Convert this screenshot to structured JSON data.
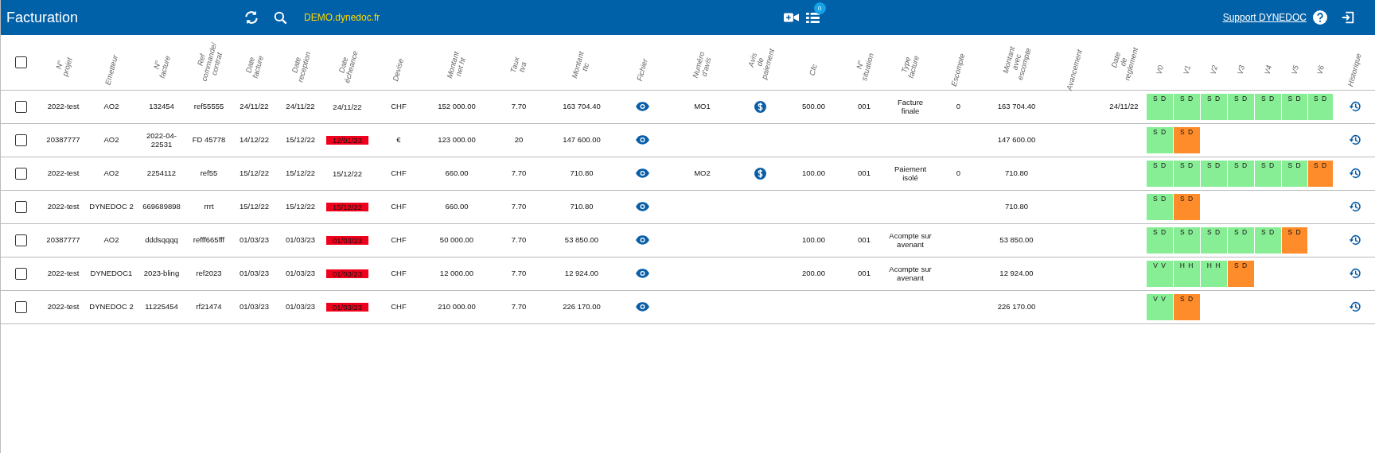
{
  "top_bar": {
    "title": "Facturation",
    "domain": "DEMO.dynedoc.fr",
    "notification_count": "0",
    "support_link": "Support DYNEDOC"
  },
  "table": {
    "all_selected": false,
    "columns": [
      {
        "label": "N°\nprojet",
        "kind": "text"
      },
      {
        "label": "Emetteur",
        "kind": "text"
      },
      {
        "label": "N°\nfacture",
        "kind": "text"
      },
      {
        "label": "Ref\ncommande/\ncontrat",
        "kind": "text"
      },
      {
        "label": "Date\nfacture",
        "kind": "text"
      },
      {
        "label": "Date\nreception",
        "kind": "text"
      },
      {
        "label": "Date\nécheance",
        "kind": "due"
      },
      {
        "label": "Devise",
        "kind": "text"
      },
      {
        "label": "Montant\nnet ht",
        "kind": "text"
      },
      {
        "label": "Taux\ntva",
        "kind": "text"
      },
      {
        "label": "Montant\nttc",
        "kind": "text"
      },
      {
        "label": "Fichier",
        "kind": "file"
      },
      {
        "label": "Numéro\nd'avis",
        "kind": "text"
      },
      {
        "label": "Avis\nde\npaiement",
        "kind": "payment"
      },
      {
        "label": "Cfc",
        "kind": "text"
      },
      {
        "label": "N°\nsituation",
        "kind": "text"
      },
      {
        "label": "Type\nfacture",
        "kind": "text"
      },
      {
        "label": "Escompte",
        "kind": "text"
      },
      {
        "label": "Montant\navec\nescompte",
        "kind": "text"
      },
      {
        "label": "Avancement",
        "kind": "text"
      },
      {
        "label": "Date\nde\nreglement",
        "kind": "text"
      },
      {
        "label": "V0",
        "kind": "version"
      },
      {
        "label": "V1",
        "kind": "version"
      },
      {
        "label": "V2",
        "kind": "version"
      },
      {
        "label": "V3",
        "kind": "version"
      },
      {
        "label": "V4",
        "kind": "version"
      },
      {
        "label": "V5",
        "kind": "version"
      },
      {
        "label": "V6",
        "kind": "version"
      },
      {
        "label": "Historique",
        "kind": "history"
      }
    ],
    "rows": [
      {
        "selected": false,
        "cells": [
          "2022-test",
          "AO2",
          "132454",
          "ref55555",
          "24/11/22",
          "24/11/22",
          {
            "text": "24/11/22",
            "overdue": false
          },
          "CHF",
          "152 000.00",
          "7.70",
          "163 704.40",
          true,
          "MO1",
          true,
          "500.00",
          "001",
          "Facture\nfinale",
          "0",
          "163 704.40",
          null,
          "24/11/22",
          {
            "text": "S D",
            "color": "#88ee96"
          },
          {
            "text": "S D",
            "color": "#88ee96"
          },
          {
            "text": "S D",
            "color": "#88ee96"
          },
          {
            "text": "S D",
            "color": "#88ee96"
          },
          {
            "text": "S D",
            "color": "#88ee96"
          },
          {
            "text": "S D",
            "color": "#88ee96"
          },
          {
            "text": "S D",
            "color": "#88ee96"
          },
          true
        ]
      },
      {
        "selected": false,
        "cells": [
          "20387777",
          "AO2",
          "2022-04-\n22531",
          "FD 45778",
          "14/12/22",
          "15/12/22",
          {
            "text": "12/01/23",
            "overdue": true
          },
          "€",
          "123 000.00",
          "20",
          "147 600.00",
          true,
          null,
          false,
          null,
          null,
          null,
          null,
          "147 600.00",
          null,
          null,
          {
            "text": "S D",
            "color": "#88ee96"
          },
          {
            "text": "S D",
            "color": "#ff8c2a"
          },
          null,
          null,
          null,
          null,
          null,
          true
        ]
      },
      {
        "selected": false,
        "cells": [
          "2022-test",
          "AO2",
          "2254112",
          "ref55",
          "15/12/22",
          "15/12/22",
          {
            "text": "15/12/22",
            "overdue": false
          },
          "CHF",
          "660.00",
          "7.70",
          "710.80",
          true,
          "MO2",
          true,
          "100.00",
          "001",
          "Paiement\nisolé",
          "0",
          "710.80",
          null,
          null,
          {
            "text": "S D",
            "color": "#88ee96"
          },
          {
            "text": "S D",
            "color": "#88ee96"
          },
          {
            "text": "S D",
            "color": "#88ee96"
          },
          {
            "text": "S D",
            "color": "#88ee96"
          },
          {
            "text": "S D",
            "color": "#88ee96"
          },
          {
            "text": "S D",
            "color": "#88ee96"
          },
          {
            "text": "S D",
            "color": "#ff8c2a"
          },
          true
        ]
      },
      {
        "selected": false,
        "cells": [
          "2022-test",
          "DYNEDOC 2",
          "669689898",
          "rrrt",
          "15/12/22",
          "15/12/22",
          {
            "text": "15/12/22",
            "overdue": true
          },
          "CHF",
          "660.00",
          "7.70",
          "710.80",
          true,
          null,
          false,
          null,
          null,
          null,
          null,
          "710.80",
          null,
          null,
          {
            "text": "S D",
            "color": "#88ee96"
          },
          {
            "text": "S D",
            "color": "#ff8c2a"
          },
          null,
          null,
          null,
          null,
          null,
          true
        ]
      },
      {
        "selected": false,
        "cells": [
          "20387777",
          "AO2",
          "dddsqqqq",
          "refff665fff",
          "01/03/23",
          "01/03/23",
          {
            "text": "01/03/23",
            "overdue": true
          },
          "CHF",
          "50 000.00",
          "7.70",
          "53 850.00",
          true,
          null,
          false,
          "100.00",
          "001",
          "Acompte sur\navenant",
          null,
          "53 850.00",
          null,
          null,
          {
            "text": "S D",
            "color": "#88ee96"
          },
          {
            "text": "S D",
            "color": "#88ee96"
          },
          {
            "text": "S D",
            "color": "#88ee96"
          },
          {
            "text": "S D",
            "color": "#88ee96"
          },
          {
            "text": "S D",
            "color": "#88ee96"
          },
          {
            "text": "S D",
            "color": "#ff8c2a"
          },
          null,
          true
        ]
      },
      {
        "selected": false,
        "cells": [
          "2022-test",
          "DYNEDOC1",
          "2023-bling",
          "ref2023",
          "01/03/23",
          "01/03/23",
          {
            "text": "01/03/23",
            "overdue": true
          },
          "CHF",
          "12 000.00",
          "7.70",
          "12 924.00",
          true,
          null,
          false,
          "200.00",
          "001",
          "Acompte sur\navenant",
          null,
          "12 924.00",
          null,
          null,
          {
            "text": "V V",
            "color": "#88ee96"
          },
          {
            "text": "H H",
            "color": "#88ee96"
          },
          {
            "text": "H H",
            "color": "#88ee96"
          },
          {
            "text": "S D",
            "color": "#ff8c2a"
          },
          null,
          null,
          null,
          true
        ]
      },
      {
        "selected": false,
        "cells": [
          "2022-test",
          "DYNEDOC 2",
          "11225454",
          "rf21474",
          "01/03/23",
          "01/03/23",
          {
            "text": "01/03/23",
            "overdue": true
          },
          "CHF",
          "210 000.00",
          "7.70",
          "226 170.00",
          true,
          null,
          false,
          null,
          null,
          null,
          null,
          "226 170.00",
          null,
          null,
          {
            "text": "V V",
            "color": "#88ee96"
          },
          {
            "text": "S D",
            "color": "#ff8c2a"
          },
          null,
          null,
          null,
          null,
          null,
          true
        ]
      }
    ]
  }
}
